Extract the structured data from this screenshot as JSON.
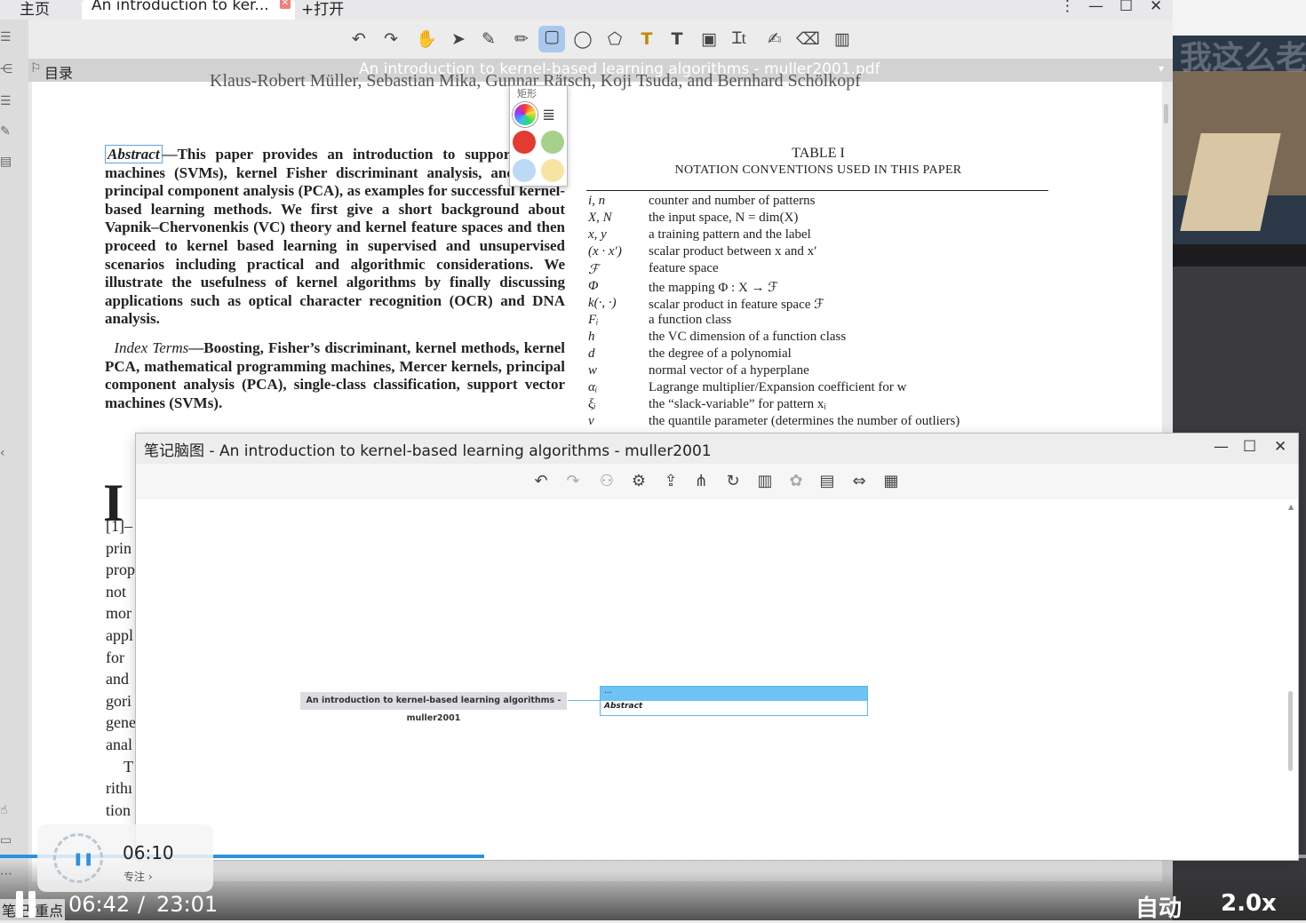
{
  "tabs": {
    "home": "主页",
    "doc": "An introduction to ker...",
    "open": "+打开"
  },
  "window_controls": {
    "more": "⋮",
    "min": "—",
    "max": "☐",
    "close": "✕"
  },
  "sidebar": {
    "toc_label": "目录"
  },
  "doc_title": "An introduction to kernel-based learning algorithms - muller2001.pdf",
  "page": {
    "author_cut": "Klaus-Robert Müller, Sebastian Mika, Gunnar Rätsch, Koji Tsuda, and Bernhard Schölkopf",
    "abstract_label": "Abstract",
    "abstract_text": "—This paper provides an introduction to support vector machines (SVMs), kernel Fisher discriminant analysis, and kernel principal component analysis (PCA), as examples for successful kernel-based learning methods. We first give a short background about Vapnik–Chervonenkis (VC) theory and kernel feature spaces and then proceed to kernel based learning in supervised and unsupervised scenarios including practical and algorithmic considerations. We illustrate the usefulness of kernel algorithms by finally discussing applications such as optical character recognition (OCR) and DNA analysis.",
    "index_label": "Index Terms",
    "index_text": "—Boosting, Fisher’s discriminant, kernel methods, kernel PCA, mathematical programming machines, Mercer kernels, principal component analysis (PCA), single-class classification, support vector machines (SVMs).",
    "big_initial": "I",
    "body_fragments": [
      "[1]–",
      "prin",
      "prop",
      "not",
      "mor",
      "appl",
      "for",
      "and",
      "gori",
      "gene",
      "anal",
      "T",
      "rithı",
      "tion"
    ],
    "table_title": "TABLE I",
    "table_subtitle": "NOTATION CONVENTIONS USED IN THIS PAPER",
    "table_rows": [
      {
        "sym": "i, n",
        "desc": "counter and number of patterns"
      },
      {
        "sym": "X, N",
        "desc": "the input space, N = dim(X)"
      },
      {
        "sym": "x, y",
        "desc": "a training pattern and the label"
      },
      {
        "sym": "(x · x′)",
        "desc": "scalar product between x and x′"
      },
      {
        "sym": "ℱ",
        "desc": "feature space"
      },
      {
        "sym": "Φ",
        "desc": "the mapping Φ : X → ℱ"
      },
      {
        "sym": "k(·, ·)",
        "desc": "scalar product in feature space ℱ"
      },
      {
        "sym": "Fᵢ",
        "desc": "a function class"
      },
      {
        "sym": "h",
        "desc": "the VC dimension of a function class"
      },
      {
        "sym": "d",
        "desc": "the degree of a polynomial"
      },
      {
        "sym": "w",
        "desc": "normal vector of a hyperplane"
      },
      {
        "sym": "αᵢ",
        "desc": "Lagrange multiplier/Expansion coefficient for w"
      },
      {
        "sym": "ξᵢ",
        "desc": "the “slack-variable” for pattern xᵢ"
      },
      {
        "sym": "ν",
        "desc": "the quantile parameter (determines the number of outliers)"
      }
    ]
  },
  "picker": {
    "title": "矩形",
    "colors": [
      "#e23b2f",
      "#a8d08d",
      "#bcd9f5",
      "#f7e3a3"
    ]
  },
  "right_panel": {
    "overlay_text": "我这么老"
  },
  "mindmap": {
    "title": "笔记脑图 - An introduction to kernel-based learning algorithms - muller2001",
    "root": "An introduction to kernel-based learning algorithms - muller2001",
    "child_head": "...",
    "child_text": "Abstract"
  },
  "player": {
    "current": "06:42",
    "sep": "/",
    "total": "23:01",
    "progress": 0.371,
    "auto": "自动",
    "speed": "2.0x",
    "focus_time": "06:10",
    "focus_label": "专注 ›",
    "note_label": "笔记 重点"
  },
  "colors": {
    "accent": "#2c92e0",
    "highlight_border": "#5fa4e6",
    "mindmap_node": "#6cc3f4"
  }
}
